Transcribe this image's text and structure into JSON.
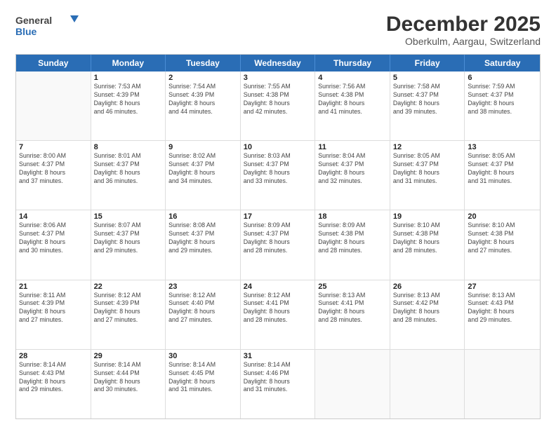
{
  "logo": {
    "line1": "General",
    "line2": "Blue"
  },
  "title": "December 2025",
  "subtitle": "Oberkulm, Aargau, Switzerland",
  "header_days": [
    "Sunday",
    "Monday",
    "Tuesday",
    "Wednesday",
    "Thursday",
    "Friday",
    "Saturday"
  ],
  "weeks": [
    [
      {
        "date": "",
        "sunrise": "",
        "sunset": "",
        "daylight": ""
      },
      {
        "date": "1",
        "sunrise": "Sunrise: 7:53 AM",
        "sunset": "Sunset: 4:39 PM",
        "daylight": "Daylight: 8 hours and 46 minutes."
      },
      {
        "date": "2",
        "sunrise": "Sunrise: 7:54 AM",
        "sunset": "Sunset: 4:39 PM",
        "daylight": "Daylight: 8 hours and 44 minutes."
      },
      {
        "date": "3",
        "sunrise": "Sunrise: 7:55 AM",
        "sunset": "Sunset: 4:38 PM",
        "daylight": "Daylight: 8 hours and 42 minutes."
      },
      {
        "date": "4",
        "sunrise": "Sunrise: 7:56 AM",
        "sunset": "Sunset: 4:38 PM",
        "daylight": "Daylight: 8 hours and 41 minutes."
      },
      {
        "date": "5",
        "sunrise": "Sunrise: 7:58 AM",
        "sunset": "Sunset: 4:37 PM",
        "daylight": "Daylight: 8 hours and 39 minutes."
      },
      {
        "date": "6",
        "sunrise": "Sunrise: 7:59 AM",
        "sunset": "Sunset: 4:37 PM",
        "daylight": "Daylight: 8 hours and 38 minutes."
      }
    ],
    [
      {
        "date": "7",
        "sunrise": "Sunrise: 8:00 AM",
        "sunset": "Sunset: 4:37 PM",
        "daylight": "Daylight: 8 hours and 37 minutes."
      },
      {
        "date": "8",
        "sunrise": "Sunrise: 8:01 AM",
        "sunset": "Sunset: 4:37 PM",
        "daylight": "Daylight: 8 hours and 36 minutes."
      },
      {
        "date": "9",
        "sunrise": "Sunrise: 8:02 AM",
        "sunset": "Sunset: 4:37 PM",
        "daylight": "Daylight: 8 hours and 34 minutes."
      },
      {
        "date": "10",
        "sunrise": "Sunrise: 8:03 AM",
        "sunset": "Sunset: 4:37 PM",
        "daylight": "Daylight: 8 hours and 33 minutes."
      },
      {
        "date": "11",
        "sunrise": "Sunrise: 8:04 AM",
        "sunset": "Sunset: 4:37 PM",
        "daylight": "Daylight: 8 hours and 32 minutes."
      },
      {
        "date": "12",
        "sunrise": "Sunrise: 8:05 AM",
        "sunset": "Sunset: 4:37 PM",
        "daylight": "Daylight: 8 hours and 31 minutes."
      },
      {
        "date": "13",
        "sunrise": "Sunrise: 8:05 AM",
        "sunset": "Sunset: 4:37 PM",
        "daylight": "Daylight: 8 hours and 31 minutes."
      }
    ],
    [
      {
        "date": "14",
        "sunrise": "Sunrise: 8:06 AM",
        "sunset": "Sunset: 4:37 PM",
        "daylight": "Daylight: 8 hours and 30 minutes."
      },
      {
        "date": "15",
        "sunrise": "Sunrise: 8:07 AM",
        "sunset": "Sunset: 4:37 PM",
        "daylight": "Daylight: 8 hours and 29 minutes."
      },
      {
        "date": "16",
        "sunrise": "Sunrise: 8:08 AM",
        "sunset": "Sunset: 4:37 PM",
        "daylight": "Daylight: 8 hours and 29 minutes."
      },
      {
        "date": "17",
        "sunrise": "Sunrise: 8:09 AM",
        "sunset": "Sunset: 4:37 PM",
        "daylight": "Daylight: 8 hours and 28 minutes."
      },
      {
        "date": "18",
        "sunrise": "Sunrise: 8:09 AM",
        "sunset": "Sunset: 4:38 PM",
        "daylight": "Daylight: 8 hours and 28 minutes."
      },
      {
        "date": "19",
        "sunrise": "Sunrise: 8:10 AM",
        "sunset": "Sunset: 4:38 PM",
        "daylight": "Daylight: 8 hours and 28 minutes."
      },
      {
        "date": "20",
        "sunrise": "Sunrise: 8:10 AM",
        "sunset": "Sunset: 4:38 PM",
        "daylight": "Daylight: 8 hours and 27 minutes."
      }
    ],
    [
      {
        "date": "21",
        "sunrise": "Sunrise: 8:11 AM",
        "sunset": "Sunset: 4:39 PM",
        "daylight": "Daylight: 8 hours and 27 minutes."
      },
      {
        "date": "22",
        "sunrise": "Sunrise: 8:12 AM",
        "sunset": "Sunset: 4:39 PM",
        "daylight": "Daylight: 8 hours and 27 minutes."
      },
      {
        "date": "23",
        "sunrise": "Sunrise: 8:12 AM",
        "sunset": "Sunset: 4:40 PM",
        "daylight": "Daylight: 8 hours and 27 minutes."
      },
      {
        "date": "24",
        "sunrise": "Sunrise: 8:12 AM",
        "sunset": "Sunset: 4:41 PM",
        "daylight": "Daylight: 8 hours and 28 minutes."
      },
      {
        "date": "25",
        "sunrise": "Sunrise: 8:13 AM",
        "sunset": "Sunset: 4:41 PM",
        "daylight": "Daylight: 8 hours and 28 minutes."
      },
      {
        "date": "26",
        "sunrise": "Sunrise: 8:13 AM",
        "sunset": "Sunset: 4:42 PM",
        "daylight": "Daylight: 8 hours and 28 minutes."
      },
      {
        "date": "27",
        "sunrise": "Sunrise: 8:13 AM",
        "sunset": "Sunset: 4:43 PM",
        "daylight": "Daylight: 8 hours and 29 minutes."
      }
    ],
    [
      {
        "date": "28",
        "sunrise": "Sunrise: 8:14 AM",
        "sunset": "Sunset: 4:43 PM",
        "daylight": "Daylight: 8 hours and 29 minutes."
      },
      {
        "date": "29",
        "sunrise": "Sunrise: 8:14 AM",
        "sunset": "Sunset: 4:44 PM",
        "daylight": "Daylight: 8 hours and 30 minutes."
      },
      {
        "date": "30",
        "sunrise": "Sunrise: 8:14 AM",
        "sunset": "Sunset: 4:45 PM",
        "daylight": "Daylight: 8 hours and 31 minutes."
      },
      {
        "date": "31",
        "sunrise": "Sunrise: 8:14 AM",
        "sunset": "Sunset: 4:46 PM",
        "daylight": "Daylight: 8 hours and 31 minutes."
      },
      {
        "date": "",
        "sunrise": "",
        "sunset": "",
        "daylight": ""
      },
      {
        "date": "",
        "sunrise": "",
        "sunset": "",
        "daylight": ""
      },
      {
        "date": "",
        "sunrise": "",
        "sunset": "",
        "daylight": ""
      }
    ]
  ]
}
